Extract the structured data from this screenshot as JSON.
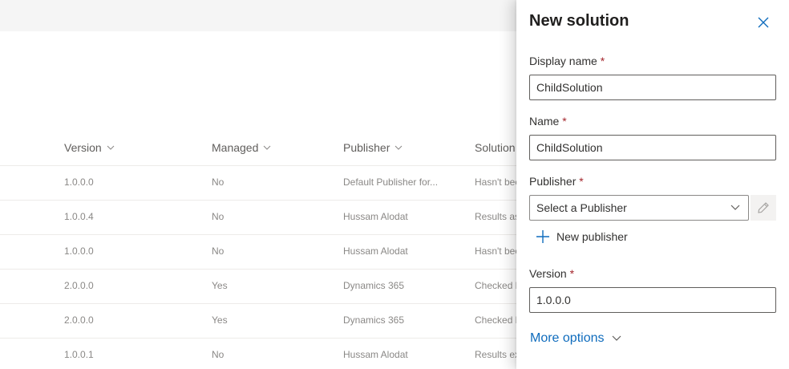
{
  "table": {
    "columns": [
      {
        "label": "Version"
      },
      {
        "label": "Managed"
      },
      {
        "label": "Publisher"
      },
      {
        "label": "Solution"
      }
    ],
    "rows": [
      {
        "version": "1.0.0.0",
        "managed": "No",
        "publisher": "Default Publisher for...",
        "solution": "Hasn't been"
      },
      {
        "version": "1.0.0.4",
        "managed": "No",
        "publisher": "Hussam Alodat",
        "solution": "Results as"
      },
      {
        "version": "1.0.0.0",
        "managed": "No",
        "publisher": "Hussam Alodat",
        "solution": "Hasn't been"
      },
      {
        "version": "2.0.0.0",
        "managed": "Yes",
        "publisher": "Dynamics 365",
        "solution": "Checked b"
      },
      {
        "version": "2.0.0.0",
        "managed": "Yes",
        "publisher": "Dynamics 365",
        "solution": "Checked b"
      },
      {
        "version": "1.0.0.1",
        "managed": "No",
        "publisher": "Hussam Alodat",
        "solution": "Results ex"
      }
    ]
  },
  "panel": {
    "title": "New solution",
    "close_icon": "close-icon",
    "required_marker": "*",
    "display_name": {
      "label": "Display name",
      "value": "ChildSolution"
    },
    "name": {
      "label": "Name",
      "value": "ChildSolution"
    },
    "publisher": {
      "label": "Publisher",
      "placeholder": "Select a Publisher",
      "edit_icon": "pencil-icon"
    },
    "new_publisher": {
      "label": "New publisher",
      "icon": "plus-icon"
    },
    "version": {
      "label": "Version",
      "value": "1.0.0.0"
    },
    "more_options": {
      "label": "More options",
      "icon": "chevron-down-icon"
    }
  },
  "colors": {
    "accent": "#0f6cbd",
    "required": "#a4262c",
    "topbar": "#f5f5f5"
  }
}
